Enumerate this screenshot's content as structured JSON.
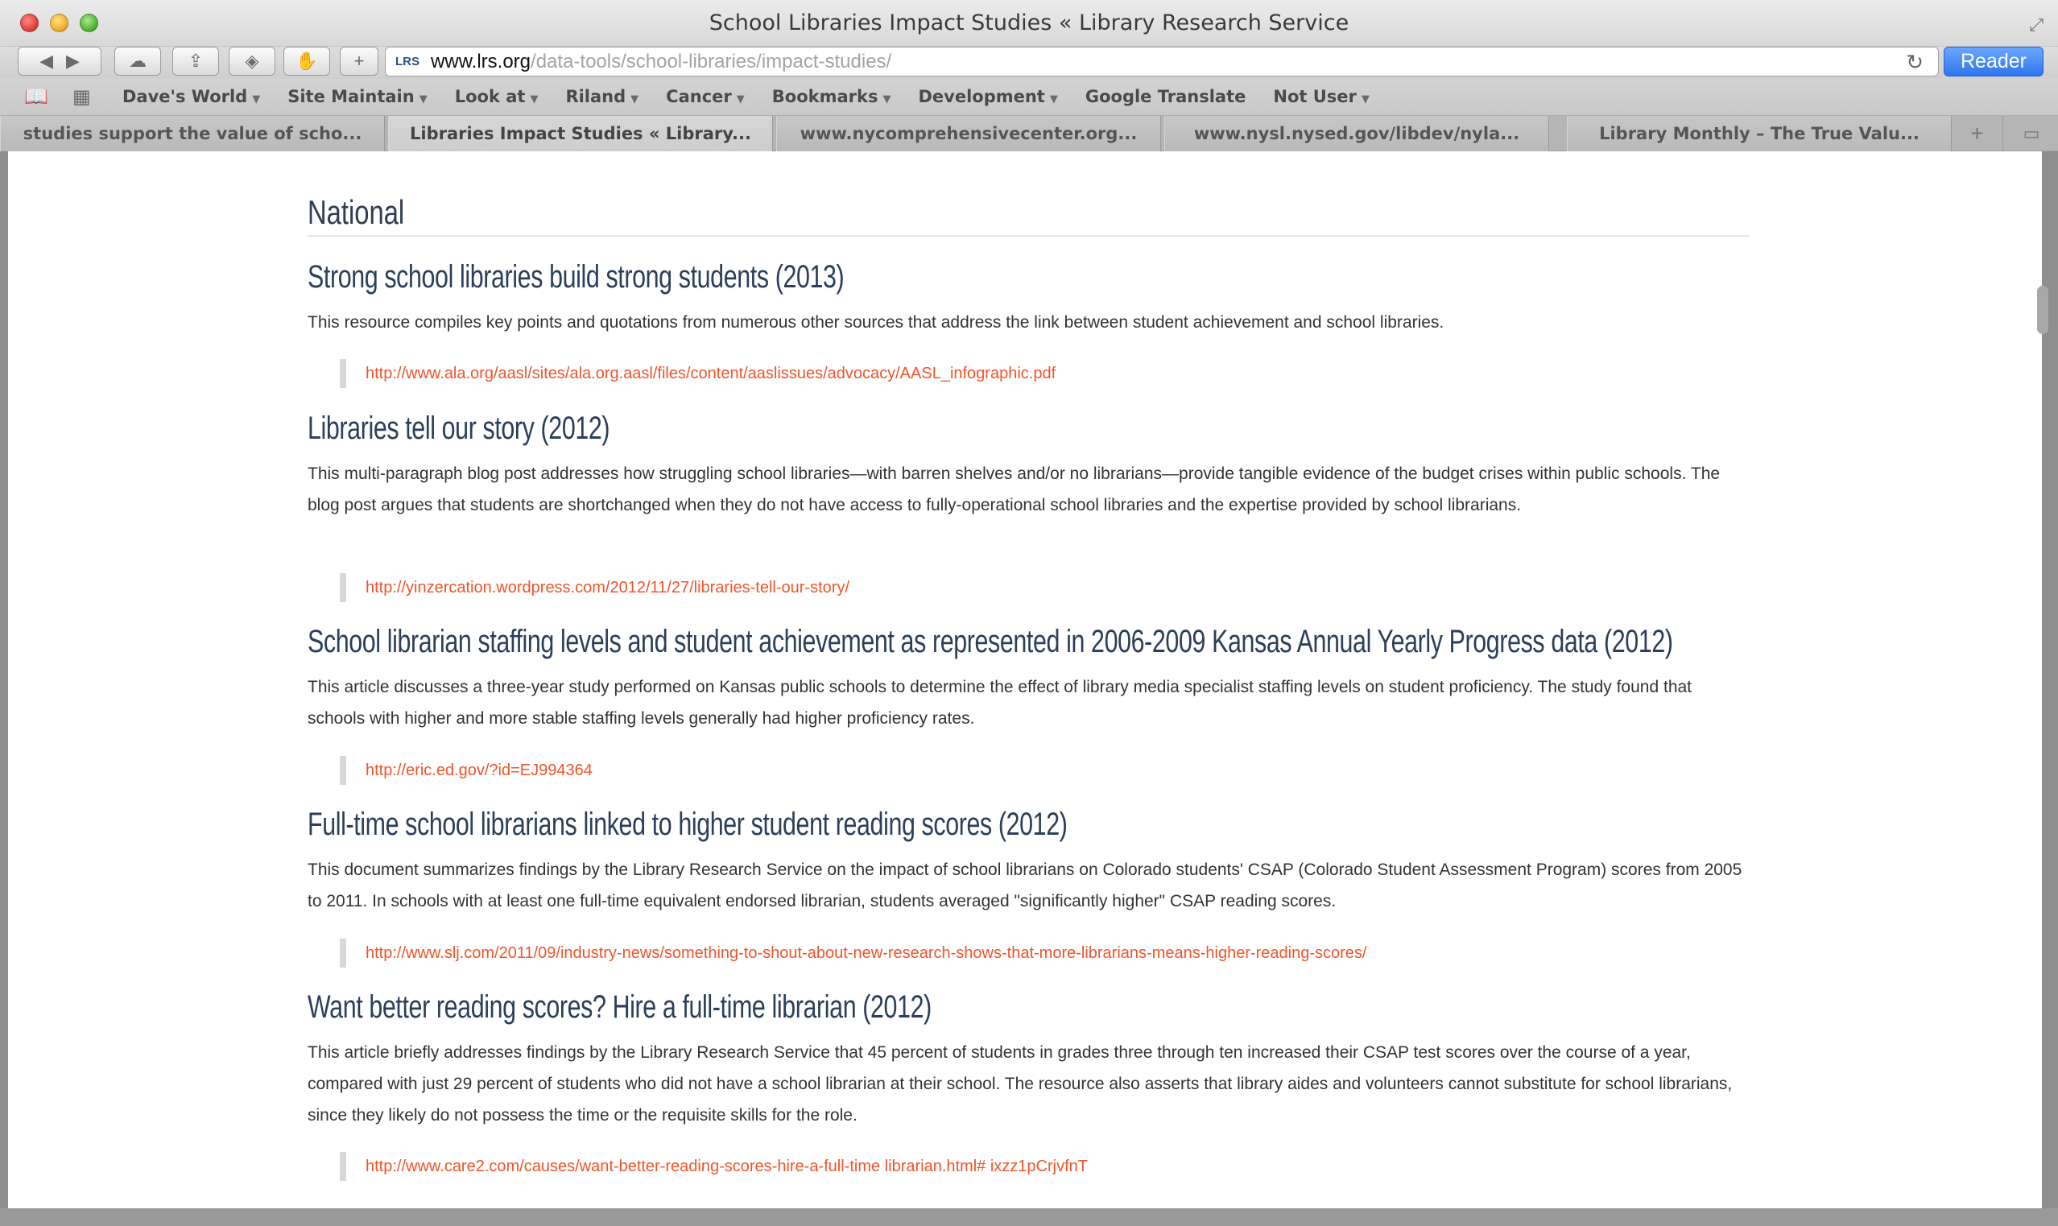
{
  "window": {
    "title": "School Libraries Impact Studies « Library Research Service"
  },
  "toolbar": {
    "url_prefix": "LRS",
    "url_domain": "www.lrs.org",
    "url_path": "/data-tools/school-libraries/impact-studies/",
    "reader_label": "Reader"
  },
  "bookmarks": [
    {
      "label": "Dave's World",
      "menu": true
    },
    {
      "label": "Site Maintain",
      "menu": true
    },
    {
      "label": "Look at",
      "menu": true
    },
    {
      "label": "Riland",
      "menu": true
    },
    {
      "label": "Cancer",
      "menu": true
    },
    {
      "label": "Bookmarks",
      "menu": true
    },
    {
      "label": "Development",
      "menu": true
    },
    {
      "label": "Google Translate",
      "menu": false
    },
    {
      "label": "Not User",
      "menu": true
    }
  ],
  "tabs": [
    {
      "label": "studies support the value of scho..."
    },
    {
      "label": "Libraries Impact Studies « Library..."
    },
    {
      "label": "www.nycomprehensivecenter.org..."
    },
    {
      "label": "www.nysl.nysed.gov/libdev/nyla..."
    },
    {
      "label": "Library Monthly – The True Valu..."
    }
  ],
  "content": {
    "section_title": "National",
    "items": [
      {
        "title": "Strong school libraries build strong students (2013)",
        "description": "This resource compiles key points and quotations from numerous other sources that address the link between student achievement and school libraries.",
        "link": "http://www.ala.org/aasl/sites/ala.org.aasl/files/content/aaslissues/advocacy/AASL_infographic.pdf"
      },
      {
        "title": "Libraries tell our story (2012)",
        "description": "This multi-paragraph blog post addresses how struggling school libraries—with barren shelves and/or no librarians—provide tangible evidence of the budget crises within public schools. The blog post argues that students are shortchanged when they do not have access to fully-operational school libraries and the expertise provided by school librarians.",
        "link": "http://yinzercation.wordpress.com/2012/11/27/libraries-tell-our-story/"
      },
      {
        "title": "School librarian staffing levels and student achievement as represented in 2006-2009 Kansas Annual Yearly Progress data (2012)",
        "description": "This article discusses a three-year study performed on Kansas public schools to determine the effect of library media specialist staffing levels on student proficiency. The study found that schools with higher and more stable staffing levels generally had higher proficiency rates.",
        "link": "http://eric.ed.gov/?id=EJ994364"
      },
      {
        "title": "Full-time school librarians linked to higher student reading scores (2012)",
        "description": "This document summarizes findings by the Library Research Service on the impact of school librarians on Colorado students' CSAP (Colorado Student Assessment Program) scores from 2005 to 2011. In schools with at least one full-time equivalent endorsed librarian, students averaged \"significantly higher\" CSAP reading scores.",
        "link": "http://www.slj.com/2011/09/industry-news/something-to-shout-about-new-research-shows-that-more-librarians-means-higher-reading-scores/"
      },
      {
        "title": "Want better reading scores? Hire a full-time librarian (2012)",
        "description": "This article briefly addresses findings by the Library Research Service that 45 percent of students in grades three through ten increased their CSAP test scores over the course of a year, compared with just 29 percent of students who did not have a school librarian at their school. The resource also asserts that library aides and volunteers cannot substitute for school librarians, since they likely do not possess the time or the requisite skills for the role.",
        "link": "http://www.care2.com/causes/want-better-reading-scores-hire-a-full-time librarian.html# ixzz1pCrjvfnT"
      }
    ]
  }
}
